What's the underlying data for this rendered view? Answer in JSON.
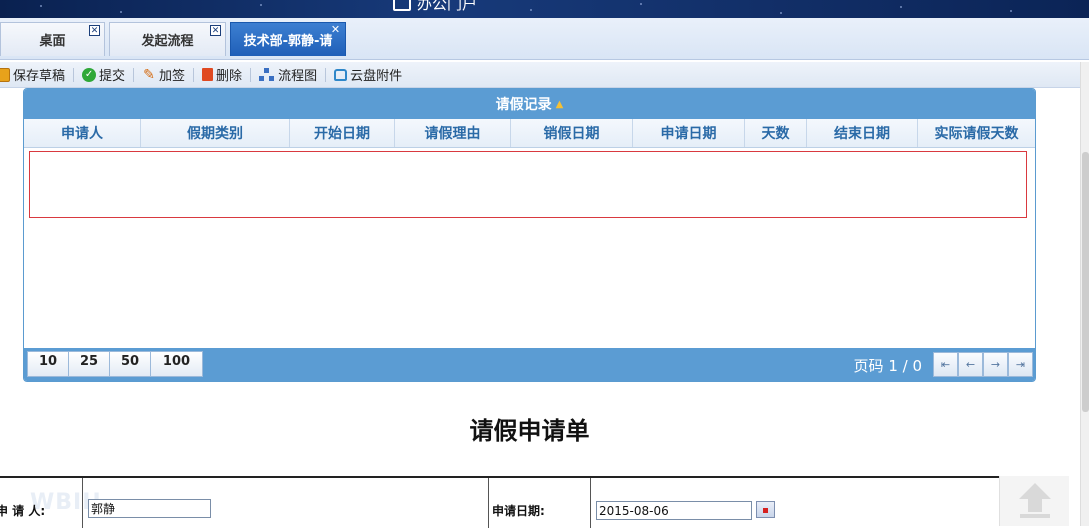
{
  "banner": {
    "title": "办公门户"
  },
  "tabs": [
    {
      "label": "桌面",
      "close": "✕"
    },
    {
      "label": "发起流程",
      "close": "✕"
    },
    {
      "label": "技术部-郭静-请",
      "close": "✕"
    }
  ],
  "toolbar": {
    "save_label": "保存草稿",
    "submit_label": "提交",
    "countersign_label": "加签",
    "delete_label": "删除",
    "flowchart_label": "流程图",
    "attachment_label": "云盘附件"
  },
  "grid": {
    "caption": "请假记录",
    "sort_marker": "▲",
    "columns": [
      "申请人",
      "假期类别",
      "开始日期",
      "请假理由",
      "销假日期",
      "申请日期",
      "天数",
      "结束日期",
      "实际请假天数"
    ],
    "rows": [],
    "page_sizes": [
      "10",
      "25",
      "50",
      "100"
    ],
    "pager_text": "页码 1 / 0",
    "pager_buttons": {
      "first": "⇤",
      "prev": "←",
      "next": "→",
      "last": "⇥"
    }
  },
  "form": {
    "title": "请假申请单",
    "applicant_label": "申 请 人:",
    "applicant_value": "郭静",
    "apply_date_label": "申请日期:",
    "apply_date_value": "2015-08-06"
  },
  "colors": {
    "grid_header": "#5b9cd3",
    "active_tab": "#1f5fb8",
    "column_text": "#2a6aa7"
  }
}
